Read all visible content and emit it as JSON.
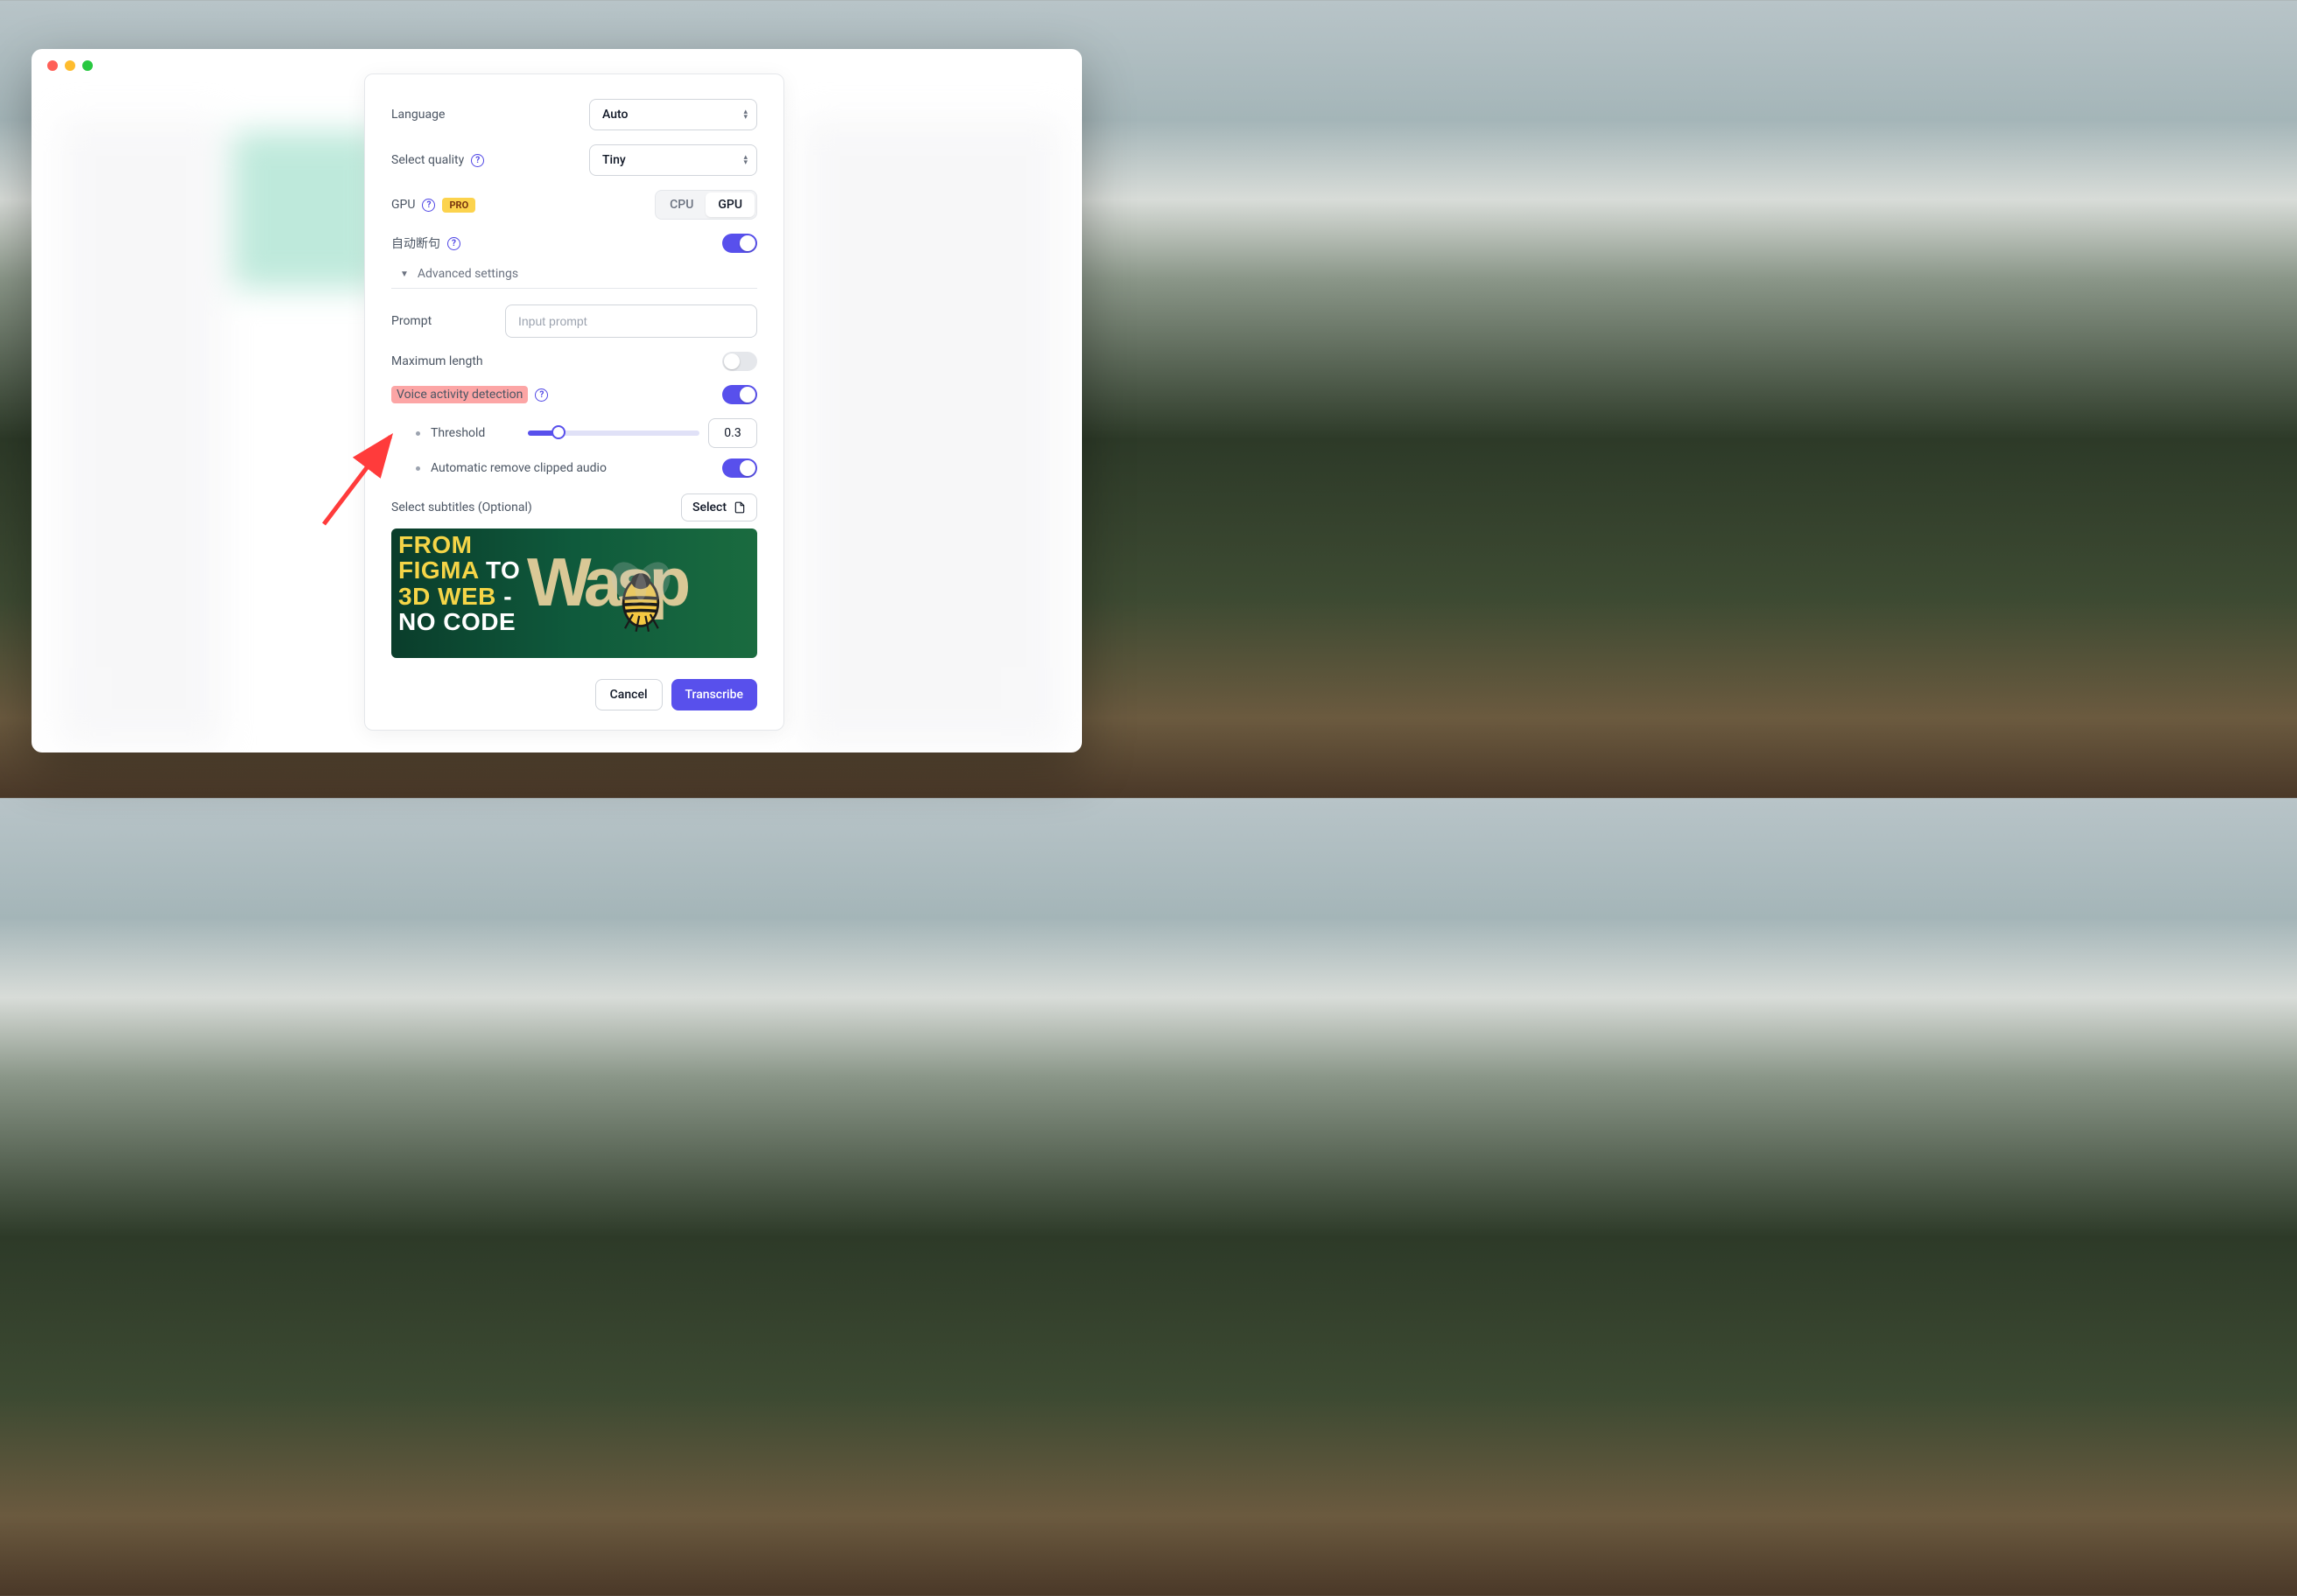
{
  "settings": {
    "language_label": "Language",
    "language_value": "Auto",
    "quality_label": "Select quality",
    "quality_value": "Tiny",
    "gpu_label": "GPU",
    "pro_badge": "PRO",
    "seg_cpu": "CPU",
    "seg_gpu": "GPU",
    "auto_sentence_label": "自动断句",
    "advanced_header": "Advanced settings",
    "prompt_label": "Prompt",
    "prompt_placeholder": "Input prompt",
    "max_length_label": "Maximum length",
    "vad_label": "Voice activity detection",
    "threshold_label": "Threshold",
    "threshold_value": "0.3",
    "remove_clipped_label": "Automatic remove clipped audio",
    "subtitles_label": "Select subtitles (Optional)",
    "select_btn": "Select",
    "cancel_btn": "Cancel",
    "transcribe_btn": "Transcribe"
  },
  "preview": {
    "line1a": "FROM",
    "line1b": "FIGMA",
    "line1c": "TO",
    "line2a": "3D WEB",
    "line2b": "-",
    "line3": "NO CODE",
    "brand": "Wasp"
  }
}
